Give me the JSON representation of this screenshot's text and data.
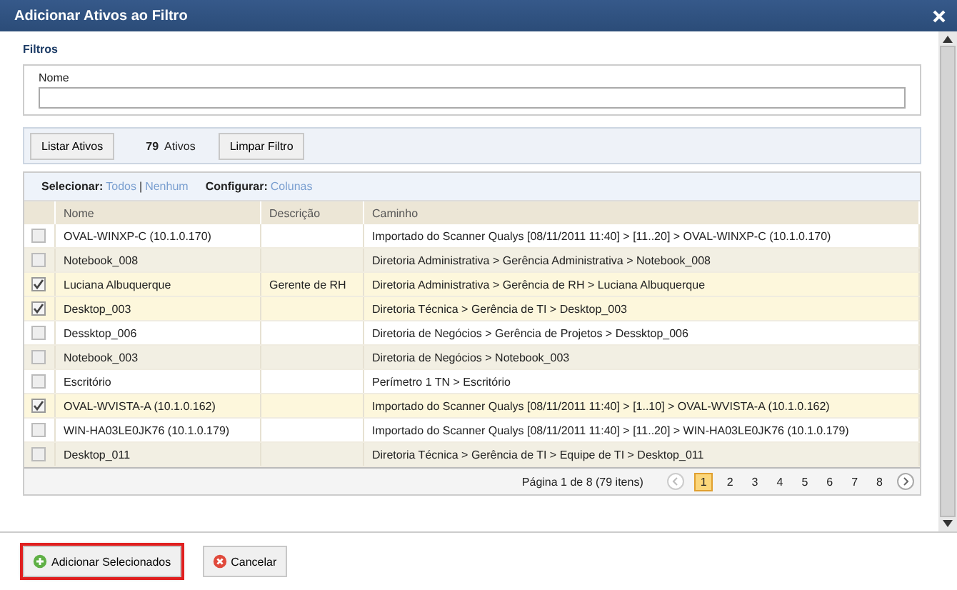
{
  "window": {
    "title": "Adicionar Ativos ao Filtro"
  },
  "filters": {
    "title": "Filtros",
    "name_field": {
      "label": "Nome"
    }
  },
  "toolbar": {
    "list_button": "Listar Ativos",
    "count": "79",
    "count_label": "Ativos",
    "clear_button": "Limpar Filtro"
  },
  "grid": {
    "select_label": "Selecionar:",
    "select_all": "Todos",
    "separator": "|",
    "select_none": "Nenhum",
    "configure_label": "Configurar:",
    "configure_columns": "Colunas",
    "columns": [
      "Nome",
      "Descrição",
      "Caminho"
    ],
    "rows": [
      {
        "name": "OVAL-WINXP-C (10.1.0.170)",
        "description": "",
        "path": "Importado do Scanner Qualys [08/11/2011 11:40] > [11..20] > OVAL-WINXP-C (10.1.0.170)",
        "checked": false
      },
      {
        "name": "Notebook_008",
        "description": "",
        "path": "Diretoria Administrativa > Gerência Administrativa > Notebook_008",
        "checked": false
      },
      {
        "name": "Luciana Albuquerque",
        "description": "Gerente de RH",
        "path": "Diretoria Administrativa > Gerência de RH > Luciana Albuquerque",
        "checked": true
      },
      {
        "name": "Desktop_003",
        "description": "",
        "path": "Diretoria Técnica > Gerência de TI > Desktop_003",
        "checked": true
      },
      {
        "name": "Dessktop_006",
        "description": "",
        "path": "Diretoria de Negócios > Gerência de Projetos > Dessktop_006",
        "checked": false
      },
      {
        "name": "Notebook_003",
        "description": "",
        "path": "Diretoria de Negócios > Notebook_003",
        "checked": false
      },
      {
        "name": "Escritório",
        "description": "",
        "path": "Perímetro 1 TN > Escritório",
        "checked": false
      },
      {
        "name": "OVAL-WVISTA-A (10.1.0.162)",
        "description": "",
        "path": "Importado do Scanner Qualys [08/11/2011 11:40] > [1..10] > OVAL-WVISTA-A (10.1.0.162)",
        "checked": true
      },
      {
        "name": "WIN-HA03LE0JK76 (10.1.0.179)",
        "description": "",
        "path": "Importado do Scanner Qualys [08/11/2011 11:40] > [11..20] > WIN-HA03LE0JK76 (10.1.0.179)",
        "checked": false
      },
      {
        "name": "Desktop_011",
        "description": "",
        "path": "Diretoria Técnica > Gerência de TI > Equipe de TI > Desktop_011",
        "checked": false
      }
    ],
    "pager": {
      "info": "Página 1 de 8 (79 itens)",
      "pages": [
        {
          "label": "1",
          "selected": true
        },
        {
          "label": "2",
          "selected": false
        },
        {
          "label": "3",
          "selected": false
        },
        {
          "label": "4",
          "selected": false
        },
        {
          "label": "5",
          "selected": false
        },
        {
          "label": "6",
          "selected": false
        },
        {
          "label": "7",
          "selected": false
        },
        {
          "label": "8",
          "selected": false
        }
      ]
    }
  },
  "footer": {
    "add_button": "Adicionar Selecionados",
    "cancel_button": "Cancelar"
  }
}
